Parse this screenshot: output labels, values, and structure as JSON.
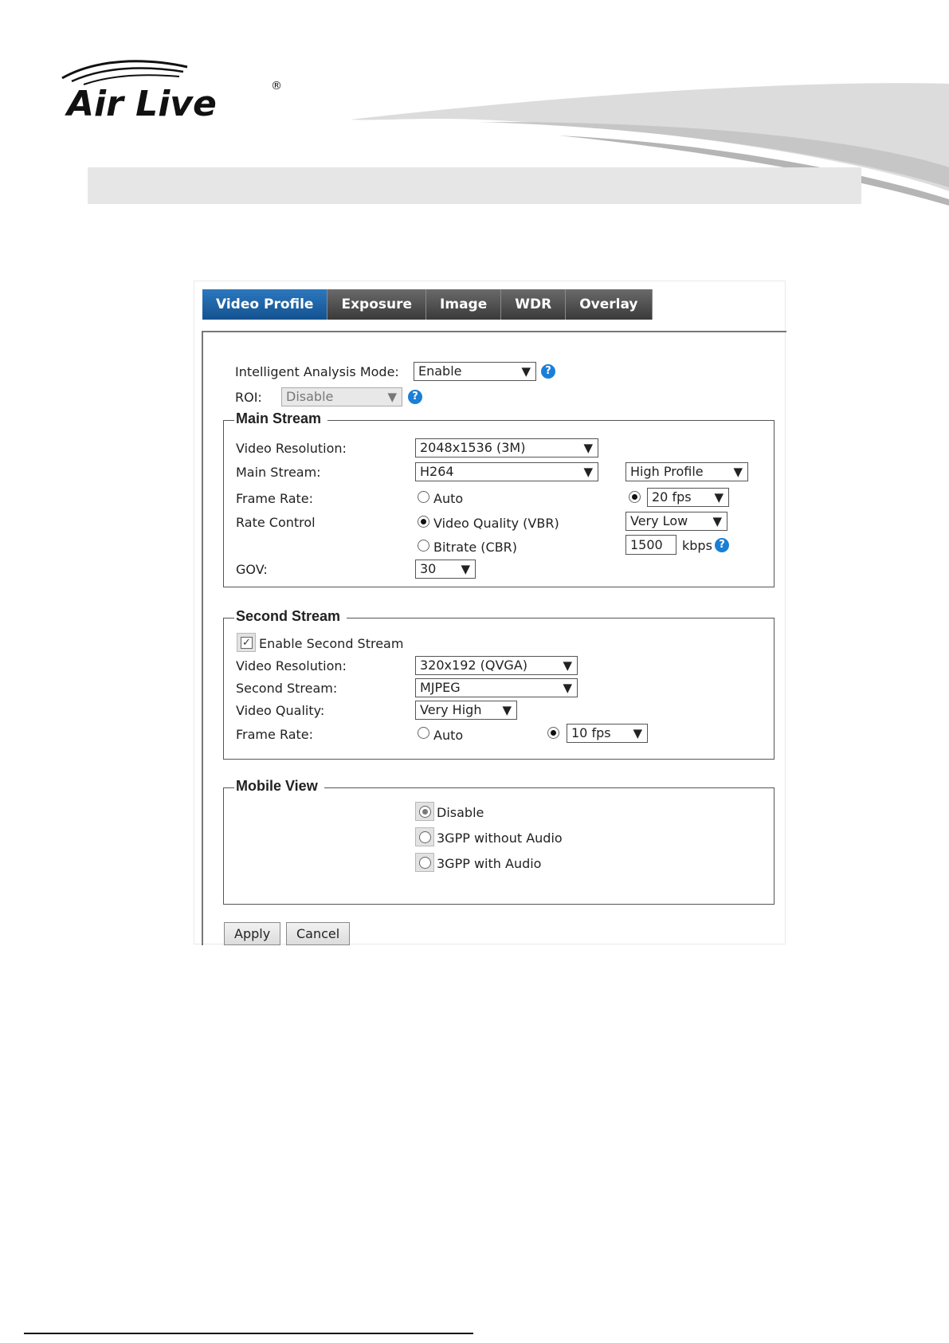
{
  "brand": {
    "name": "Air Live",
    "registered": "®"
  },
  "tabs": [
    "Video Profile",
    "Exposure",
    "Image",
    "WDR",
    "Overlay"
  ],
  "general": {
    "intelligent_label": "Intelligent Analysis Mode:",
    "intelligent_value": "Enable",
    "roi_label": "ROI:",
    "roi_value": "Disable"
  },
  "main_stream": {
    "legend": "Main Stream",
    "video_resolution_label": "Video Resolution:",
    "video_resolution_value": "2048x1536 (3M)",
    "main_stream_label": "Main Stream:",
    "main_stream_value": "H264",
    "profile_value": "High Profile",
    "frame_rate_label": "Frame Rate:",
    "auto_label": "Auto",
    "fps_value": "20 fps",
    "rate_control_label": "Rate Control",
    "vbr_label": "Video Quality (VBR)",
    "quality_value": "Very Low",
    "cbr_label": "Bitrate (CBR)",
    "bitrate_value": "1500",
    "bitrate_unit": "kbps",
    "gov_label": "GOV:",
    "gov_value": "30"
  },
  "second_stream": {
    "legend": "Second Stream",
    "enable_label": "Enable Second Stream",
    "video_resolution_label": "Video Resolution:",
    "video_resolution_value": "320x192 (QVGA)",
    "second_stream_label": "Second Stream:",
    "second_stream_value": "MJPEG",
    "video_quality_label": "Video Quality:",
    "video_quality_value": "Very High",
    "frame_rate_label": "Frame Rate:",
    "auto_label": "Auto",
    "fps_value": "10 fps"
  },
  "mobile_view": {
    "legend": "Mobile View",
    "options": [
      "Disable",
      "3GPP without Audio",
      "3GPP with Audio"
    ]
  },
  "buttons": {
    "apply": "Apply",
    "cancel": "Cancel"
  },
  "colors": {
    "tab_active": "#1f66ab",
    "tab": "#4a4a4a",
    "help": "#1a7fd6",
    "header_bar": "#e6e6e6"
  }
}
